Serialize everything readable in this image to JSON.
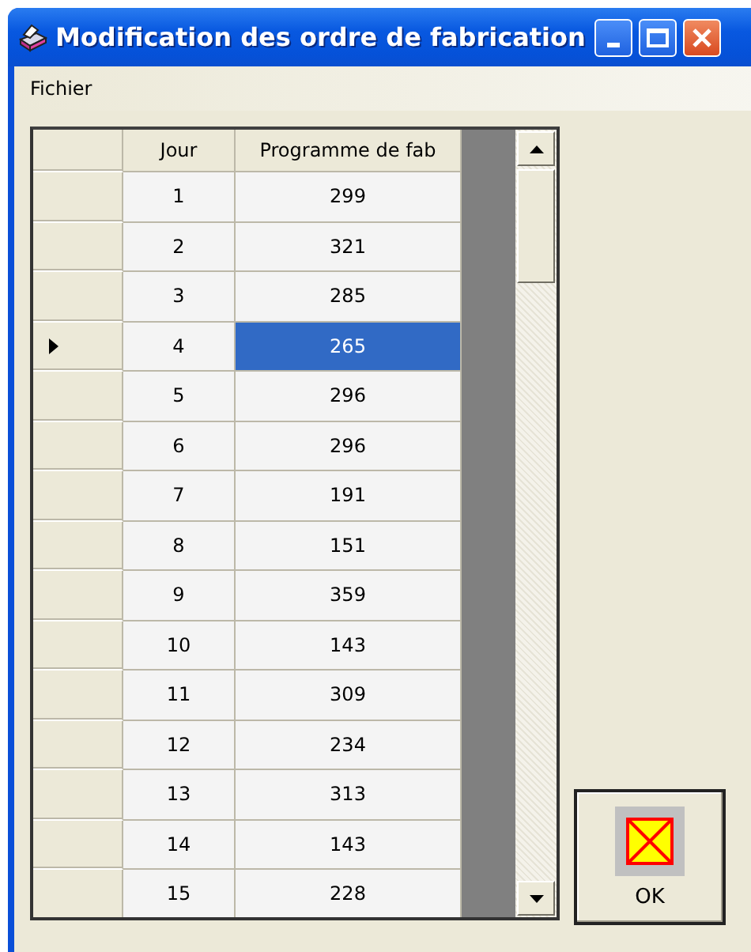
{
  "window": {
    "title": "Modification des ordre de fabrication"
  },
  "menu": [
    {
      "label": "Fichier"
    }
  ],
  "table": {
    "columns": [
      "Jour",
      "Programme de fab"
    ],
    "rows": [
      {
        "cells": [
          "1",
          "299"
        ],
        "selected": false
      },
      {
        "cells": [
          "2",
          "321"
        ],
        "selected": false
      },
      {
        "cells": [
          "3",
          "285"
        ],
        "selected": false
      },
      {
        "cells": [
          "4",
          "265"
        ],
        "selected": true
      },
      {
        "cells": [
          "5",
          "296"
        ],
        "selected": false
      },
      {
        "cells": [
          "6",
          "296"
        ],
        "selected": false
      },
      {
        "cells": [
          "7",
          "191"
        ],
        "selected": false
      },
      {
        "cells": [
          "8",
          "151"
        ],
        "selected": false
      },
      {
        "cells": [
          "9",
          "359"
        ],
        "selected": false
      },
      {
        "cells": [
          "10",
          "143"
        ],
        "selected": false
      },
      {
        "cells": [
          "11",
          "309"
        ],
        "selected": false
      },
      {
        "cells": [
          "12",
          "234"
        ],
        "selected": false
      },
      {
        "cells": [
          "13",
          "313"
        ],
        "selected": false
      },
      {
        "cells": [
          "14",
          "143"
        ],
        "selected": false
      },
      {
        "cells": [
          "15",
          "228"
        ],
        "selected": false
      }
    ]
  },
  "ok_button": {
    "label": "OK"
  }
}
